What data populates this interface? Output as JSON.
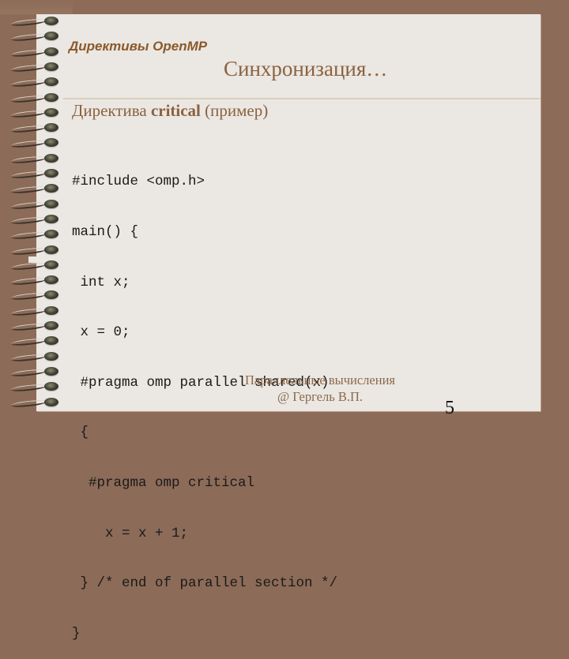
{
  "slide": {
    "section_label": "Директивы OpenMP",
    "title": "Синхронизация…",
    "subtitle": {
      "prefix": "Директива ",
      "keyword": "critical",
      "suffix": " (пример)"
    },
    "code_lines": [
      "#include <omp.h>",
      "main() {",
      " int x;",
      " x = 0;",
      " #pragma omp parallel shared(x)",
      " {",
      "  #pragma omp critical",
      "    x = x + 1;",
      " } /* end of parallel section */",
      "}"
    ],
    "footer": {
      "line1": "Параллельные вычисления",
      "line2": "@ Гергель В.П."
    },
    "page_number": "5"
  },
  "decor": {
    "spiral_icon": "spiral-binding-ring",
    "ring_count": 26
  },
  "colors": {
    "background": "#8c6b58",
    "page": "#ebe7e2",
    "accent": "#8a5a2a",
    "title": "#8a6240"
  }
}
